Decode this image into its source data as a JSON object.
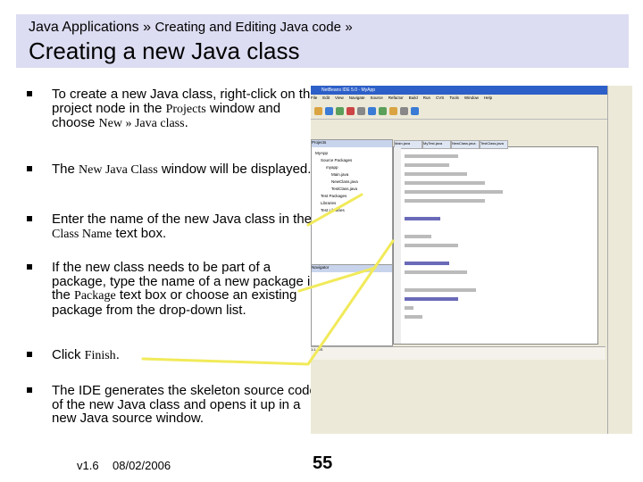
{
  "header": {
    "breadcrumb_main": "Java Applications »",
    "breadcrumb_sub": "Creating and Editing Java code",
    "breadcrumb_sep": "»",
    "title": "Creating a new Java class"
  },
  "bullets": [
    {
      "parts": [
        {
          "t": "To create a new Java class, right-click on the project node in the "
        },
        {
          "t": "Projects",
          "serif": true
        },
        {
          "t": " window and choose "
        },
        {
          "t": "New » Java class",
          "serif": true
        },
        {
          "t": "."
        }
      ]
    },
    {
      "parts": [
        {
          "t": "The "
        },
        {
          "t": "New Java Class",
          "serif": true
        },
        {
          "t": " window will be displayed."
        }
      ]
    },
    {
      "parts": [
        {
          "t": "Enter the name of the new Java class in the "
        },
        {
          "t": "Class Name",
          "serif": true
        },
        {
          "t": " text box."
        }
      ]
    },
    {
      "parts": [
        {
          "t": "If the new class needs to be part of a package, type the name of a new package in the "
        },
        {
          "t": "Package",
          "serif": true
        },
        {
          "t": " text box or choose an existing package from the drop-down list."
        }
      ]
    },
    {
      "parts": [
        {
          "t": "Click "
        },
        {
          "t": "Finish",
          "serif": true
        },
        {
          "t": "."
        }
      ]
    },
    {
      "parts": [
        {
          "t": "The IDE generates the skeleton source code of the new Java class and opens it up in a new Java source window."
        }
      ]
    }
  ],
  "footer": {
    "version": "v1.6",
    "date": "08/02/2006",
    "page_number": "55"
  },
  "screenshot": {
    "window_title": "NetBeans IDE 5.0 - MyApp",
    "menu": [
      "File",
      "Edit",
      "View",
      "Navigate",
      "Source",
      "Refactor",
      "Build",
      "Run",
      "CVS",
      "Tools",
      "Window",
      "Help"
    ],
    "projects_title": "Projects",
    "navigator_title": "Navigator",
    "tree": [
      "MyApp",
      "Source Packages",
      "myapp",
      "Main.java",
      "NewClass.java",
      "TestClass.java",
      "Test Packages",
      "Libraries",
      "Test Libraries"
    ],
    "editor_tabs": [
      "Main.java",
      "MyTest.java",
      "NewClass.java",
      "TestClass.java"
    ],
    "status_line": "1:1",
    "status_mode": "INS"
  },
  "colors": {
    "header_bg": "#dcdcf2",
    "arrow": "#f1ea5a"
  }
}
